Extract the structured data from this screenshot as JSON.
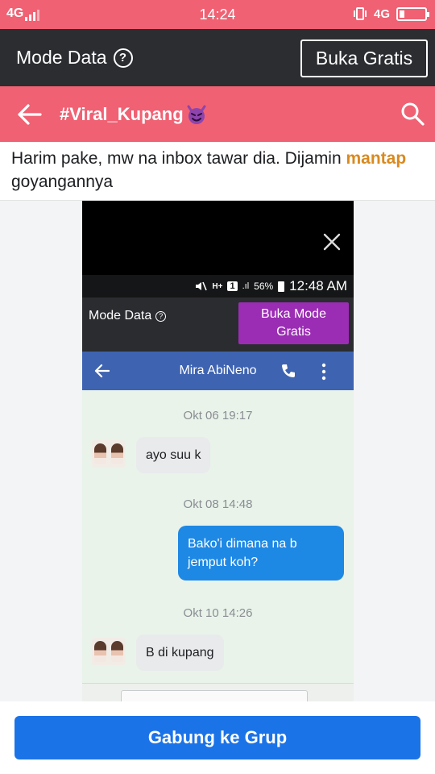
{
  "status_bar": {
    "network": "4G",
    "time": "14:24",
    "network_right": "4G",
    "colors": {
      "background": "#f06173"
    }
  },
  "mode_bar": {
    "label": "Mode Data",
    "help_icon": "?",
    "free_button": "Buka Gratis"
  },
  "group_header": {
    "title": "#Viral_Kupang",
    "title_icon": "devil-emoji",
    "back_icon": "arrow-left",
    "search_icon": "magnifier"
  },
  "post": {
    "text_part1": "Harim pake, mw na inbox tawar dia. Dijamin ",
    "highlight": "mantap",
    "text_part2": " goyangannya"
  },
  "screenshot": {
    "status": {
      "pct": "56%",
      "sim": "1",
      "time": "12:48 AM"
    },
    "mode_label": "Mode Data",
    "help": "?",
    "free_button_line1": "Buka Mode",
    "free_button_line2": "Gratis",
    "contact_name": "Mira AbiNeno",
    "messages": [
      {
        "stamp": "Okt 06 19:17",
        "text": "ayo suu k",
        "direction": "in"
      },
      {
        "stamp": "Okt 08 14:48",
        "text_line1": "Bako'i dimana na b",
        "text_line2": "jemput koh?",
        "direction": "out"
      },
      {
        "stamp": "Okt 10 14:26",
        "text": "B di kupang",
        "direction": "in"
      }
    ]
  },
  "bottom": {
    "join_button": "Gabung ke Grup",
    "colors": {
      "button": "#1b73e8"
    }
  }
}
